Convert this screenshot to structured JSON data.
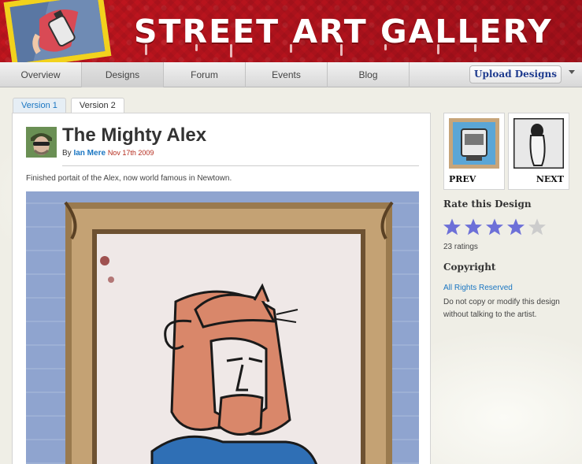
{
  "header": {
    "site_title": "STREET ART GALLERY"
  },
  "nav": {
    "items": [
      {
        "label": "Overview"
      },
      {
        "label": "Designs"
      },
      {
        "label": "Forum"
      },
      {
        "label": "Events"
      },
      {
        "label": "Blog"
      }
    ],
    "active": "Designs",
    "upload_label": "Upload Designs"
  },
  "versions": {
    "tabs": [
      "Version 1",
      "Version 2"
    ],
    "selected": "Version 2"
  },
  "design": {
    "title": "The Mighty Alex",
    "by_prefix": "By",
    "author": "Ian Mere",
    "date": "Nov 17th 2009",
    "description": "Finished portait of the Alex, now world famous in Newtown."
  },
  "sidebar": {
    "prev_label": "PREV",
    "next_label": "NEXT",
    "rate_title": "Rate this Design",
    "rating_value": 4,
    "rating_max": 5,
    "ratings_count": "23 ratings",
    "copyright_title": "Copyright",
    "rights_link": "All Rights Reserved",
    "rights_text": "Do not copy or modify this design without talking to the artist."
  },
  "colors": {
    "header_red": "#b5121b",
    "link_blue": "#1a76c2",
    "star_filled": "#6d70d8",
    "star_empty": "#cccccc",
    "date_red": "#b52b1c"
  }
}
